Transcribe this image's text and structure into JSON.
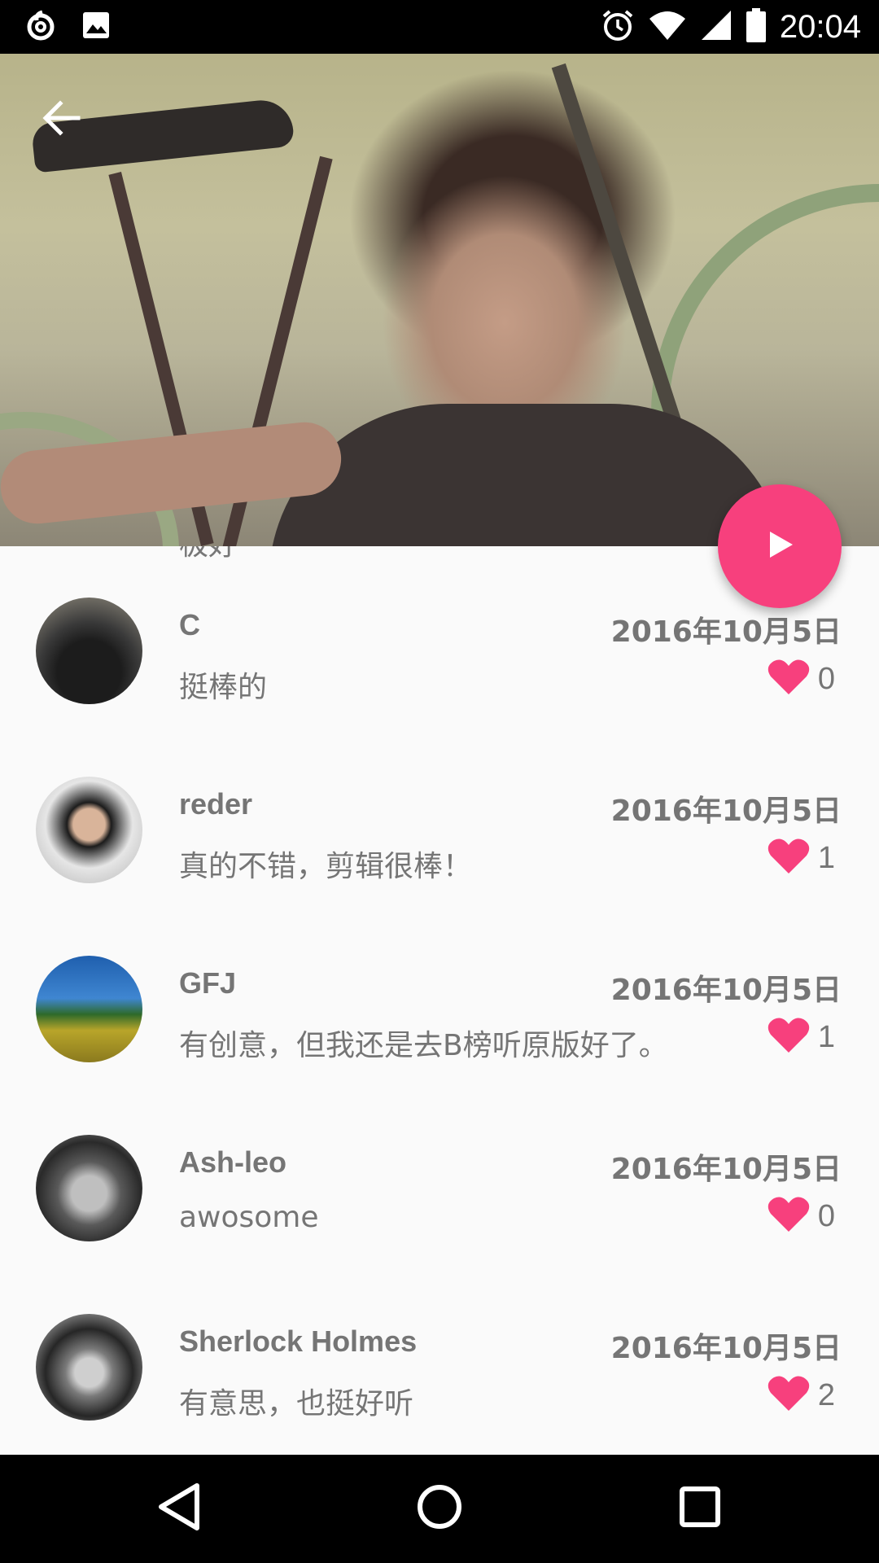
{
  "status_bar": {
    "time": "20:04",
    "left_icons": [
      "netease-music-icon",
      "image-icon"
    ],
    "right_icons": [
      "alarm-icon",
      "wifi-icon",
      "cell-signal-icon",
      "battery-icon"
    ]
  },
  "header": {
    "back_icon": "arrow-back-icon"
  },
  "fab": {
    "icon": "play-icon",
    "color": "#f7407d"
  },
  "comments": {
    "cut_off_text": "极好",
    "items": [
      {
        "user": "C",
        "date": "2016年10月5日",
        "text": "挺棒的",
        "likes": "0"
      },
      {
        "user": "reder",
        "date": "2016年10月5日",
        "text": "真的不错，剪辑很棒！",
        "likes": "1"
      },
      {
        "user": "GFJ",
        "date": "2016年10月5日",
        "text": "有创意，但我还是去B榜听原版好了。",
        "likes": "1"
      },
      {
        "user": "Ash-leo",
        "date": "2016年10月5日",
        "text": "awosome",
        "likes": "0"
      },
      {
        "user": "Sherlock Holmes",
        "date": "2016年10月5日",
        "text": "有意思，也挺好听",
        "likes": "2"
      }
    ],
    "heart_color": "#f7407d"
  },
  "nav_bar": {
    "icons": [
      "nav-back-icon",
      "nav-home-icon",
      "nav-recents-icon"
    ]
  }
}
